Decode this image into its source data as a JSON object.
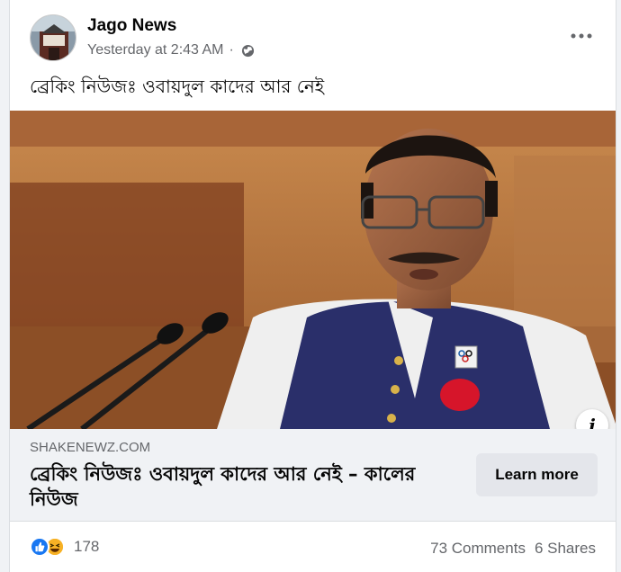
{
  "post": {
    "author": "Jago News",
    "timestamp": "Yesterday at 2:43 AM",
    "separator": "·",
    "privacy_icon": "globe-icon",
    "text": "ব্রেকিং নিউজঃ ওবায়দুল কাদের আর নেই"
  },
  "link_preview": {
    "domain": "SHAKENEWZ.COM",
    "title": "ব্রেকিং নিউজঃ ওবায়দুল কাদের আর নেই – কালের নিউজ",
    "button_label": "Learn more",
    "info_label": "i"
  },
  "footer": {
    "reaction_count": "178",
    "comments": "73 Comments",
    "shares": "6 Shares"
  },
  "colors": {
    "accent": "#1877f2",
    "haha": "#f7b125",
    "secondary_text": "#65676b"
  }
}
